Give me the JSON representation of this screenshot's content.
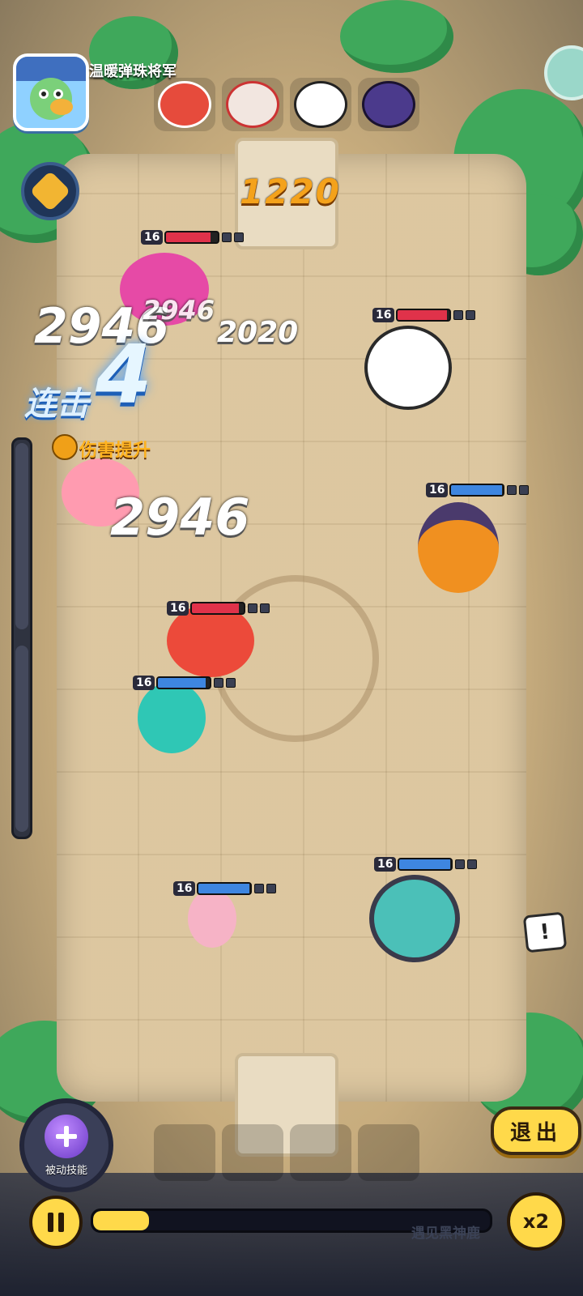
{
  "header": {
    "player_name": "温暖弹珠将军",
    "score": "1220"
  },
  "opponents": [
    {
      "icon": "red-fox-face-icon",
      "color": "#e64b3c",
      "active": true
    },
    {
      "icon": "white-fox-face-icon",
      "color": "#f2e6e0"
    },
    {
      "icon": "panda-face-icon",
      "color": "#ffffff"
    },
    {
      "icon": "purple-bull-face-icon",
      "color": "#4b3a8c"
    }
  ],
  "units": [
    {
      "name": "pink-demon",
      "side": "enemy",
      "level": "16",
      "hp": 0.85
    },
    {
      "name": "panda",
      "side": "enemy",
      "level": "16",
      "hp": 0.95
    },
    {
      "name": "red-bird",
      "side": "enemy",
      "level": "16",
      "hp": 0.9
    },
    {
      "name": "hat-clown",
      "side": "ally",
      "level": "16",
      "hp": 0.98
    },
    {
      "name": "teal-knight",
      "side": "ally",
      "level": "16",
      "hp": 0.92
    },
    {
      "name": "pink-girl",
      "side": "ally",
      "level": "16",
      "hp": 0.98
    },
    {
      "name": "zombie-ogre",
      "side": "ally",
      "level": "16",
      "hp": 0.98
    }
  ],
  "damage": {
    "big_1": "2946",
    "small_1": "2946",
    "small_2": "2020",
    "big_2": "2946"
  },
  "combo": {
    "label": "连击",
    "count": "4"
  },
  "buff": {
    "label": "伤害提升",
    "icon": "sword-up-icon"
  },
  "controls": {
    "exit_label": "退出",
    "passive_label": "被动技能",
    "speed_label": "x2",
    "alert_label": "!",
    "progress": 0.14,
    "hint": "遇见黑神鹿"
  },
  "colors": {
    "accent": "#ffd94a",
    "enemy_hp": "#e0324a",
    "ally_hp": "#3e86e0",
    "combo": "#4aa0ff"
  }
}
